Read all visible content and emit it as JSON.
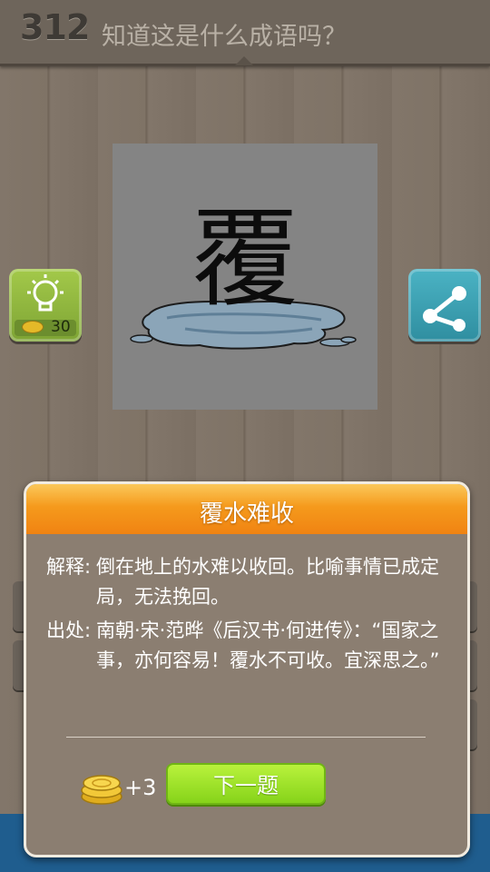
{
  "header": {
    "level": "312",
    "question": "知道这是什么成语吗？"
  },
  "puzzle": {
    "glyph": "覆",
    "hint_cost": "30"
  },
  "icons": {
    "hint": "lightbulb-icon",
    "coin": "coin-icon",
    "share": "share-icon"
  },
  "modal": {
    "title": "覆水难收",
    "explanation_label": "解释:",
    "explanation": "倒在地上的水难以收回。比喻事情已成定局，无法挽回。",
    "source_label": "出处:",
    "source": "南朝·宋·范晔《后汉书·何进传》：“国家之事，亦何容易！覆水不可收。宜深思之。”",
    "reward": "+3",
    "next_button": "下一题"
  },
  "colors": {
    "modal_header": "#f59a1c",
    "next_button": "#9be12c",
    "hint_button": "#8cb53c",
    "share_button": "#3aa2b4",
    "bottom_bar": "#1f5d8e"
  }
}
